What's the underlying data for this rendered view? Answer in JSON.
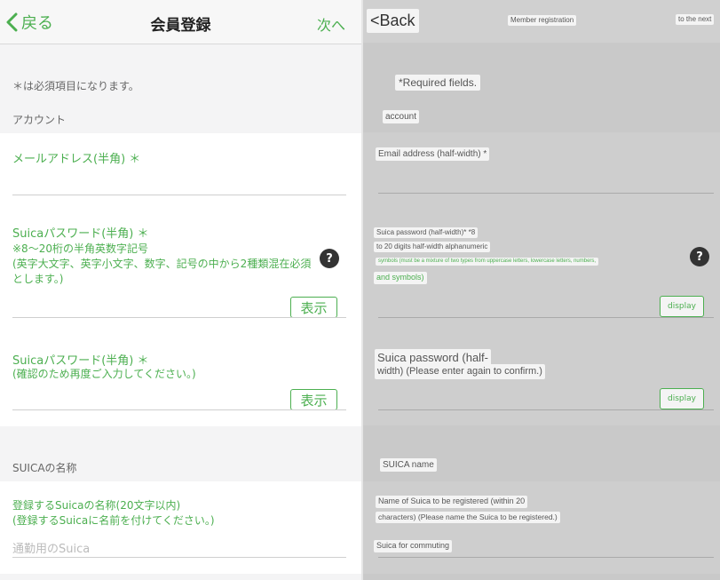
{
  "original": {
    "nav": {
      "back_label": "戻る",
      "title": "会員登録",
      "next_label": "次へ"
    },
    "required_note": "＊は必須項目になります。",
    "account_section": "アカウント",
    "email_label": "メールアドレス(半角) ＊",
    "password_label": "Suicaパスワード(半角) ＊",
    "password_hint_1": "※8～20桁の半角英数字記号",
    "password_hint_2": "(英字大文字、英字小文字、数字、記号の中から2種類混在必須",
    "password_hint_3": "とします。)",
    "show_label_1": "表示",
    "confirm_label": "Suicaパスワード(半角) ＊",
    "confirm_hint": "(確認のため再度ご入力してください。)",
    "show_label_2": "表示",
    "suica_section": "SUICAの名称",
    "suica_name_label": "登録するSuicaの名称(20文字以内)",
    "suica_name_hint": "(登録するSuicaに名前を付けてください。)",
    "suica_name_placeholder": "通勤用のSuica",
    "help_glyph": "?"
  },
  "translated": {
    "nav": {
      "back_label": "<Back",
      "title": "Member registration",
      "next_label": "to the next"
    },
    "required_note": "*Required fields.",
    "account_section": "account",
    "email_label": "Email address (half-width) *",
    "password_label": "Suica password (half-width)* *8",
    "password_hint_1": "to 20 digits half-width alphanumeric",
    "password_hint_2": "symbols (must be a mixture of two types from uppercase letters, lowercase letters, numbers,",
    "password_hint_3": "and symbols)",
    "show_label_1": "display",
    "confirm_label": "Suica password (half-",
    "confirm_hint": "width) (Please enter again to confirm.)",
    "show_label_2": "display",
    "suica_section": "SUICA name",
    "suica_name_label": "Name of Suica to be registered (within 20",
    "suica_name_hint": "characters) (Please name the Suica to be registered.)",
    "suica_name_placeholder": "Suica for commuting",
    "help_glyph": "?"
  },
  "colors": {
    "accent": "#4caf50",
    "dark": "#333333",
    "section_bg": "#f4f4f5",
    "overlay_bg": "#c9c9c9"
  },
  "icons": {
    "back": "chevron-left-icon",
    "help": "question-circle-icon"
  }
}
